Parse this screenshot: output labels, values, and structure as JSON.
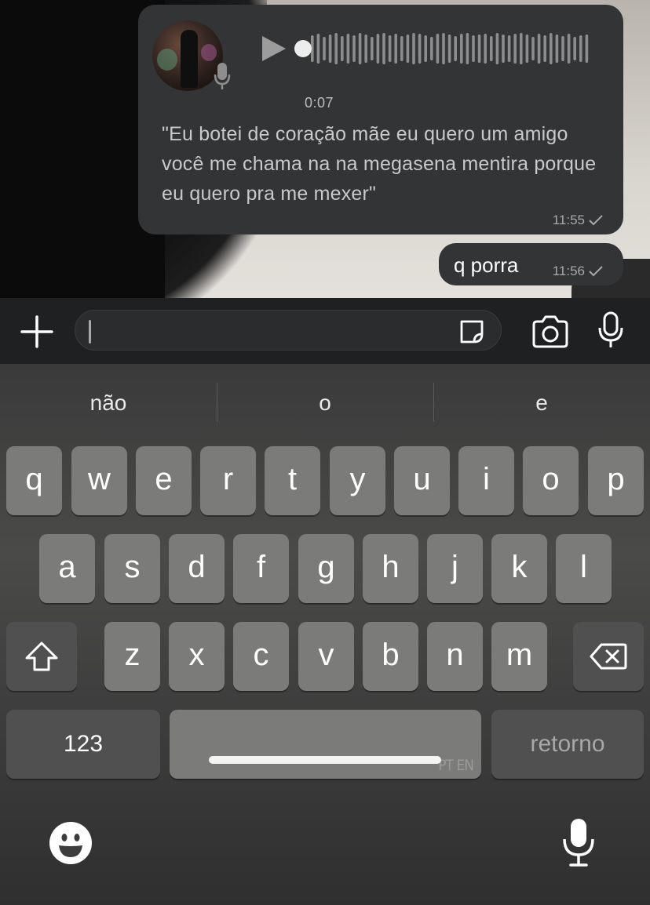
{
  "chat": {
    "voice_message": {
      "duration": "0:07",
      "transcript": "\"Eu botei de coração mãe eu quero um amigo você me chama na na megasena mentira porque eu quero pra me mexer\"",
      "time": "11:55",
      "status_icon": "single-check-icon"
    },
    "text_message": {
      "text": "q porra",
      "time": "11:56",
      "status_icon": "single-check-icon"
    }
  },
  "input_bar": {
    "plus_icon": "plus-icon",
    "sticker_icon": "sticker-icon",
    "camera_icon": "camera-icon",
    "mic_icon": "microphone-icon",
    "message_value": ""
  },
  "keyboard": {
    "suggestions": [
      "não",
      "o",
      "e"
    ],
    "row1": [
      "q",
      "w",
      "e",
      "r",
      "t",
      "y",
      "u",
      "i",
      "o",
      "p"
    ],
    "row2": [
      "a",
      "s",
      "d",
      "f",
      "g",
      "h",
      "j",
      "k",
      "l"
    ],
    "row3": [
      "z",
      "x",
      "c",
      "v",
      "b",
      "n",
      "m"
    ],
    "numbers_label": "123",
    "space_label": "PT EN",
    "return_label": "retorno",
    "shift_icon": "shift-icon",
    "backspace_icon": "backspace-icon",
    "emoji_icon": "emoji-icon",
    "dictation_icon": "microphone-icon"
  },
  "colors": {
    "bubble": "#333435",
    "key": "#7b7b79",
    "key_dark": "#505050",
    "input_bar": "#1f2021"
  }
}
